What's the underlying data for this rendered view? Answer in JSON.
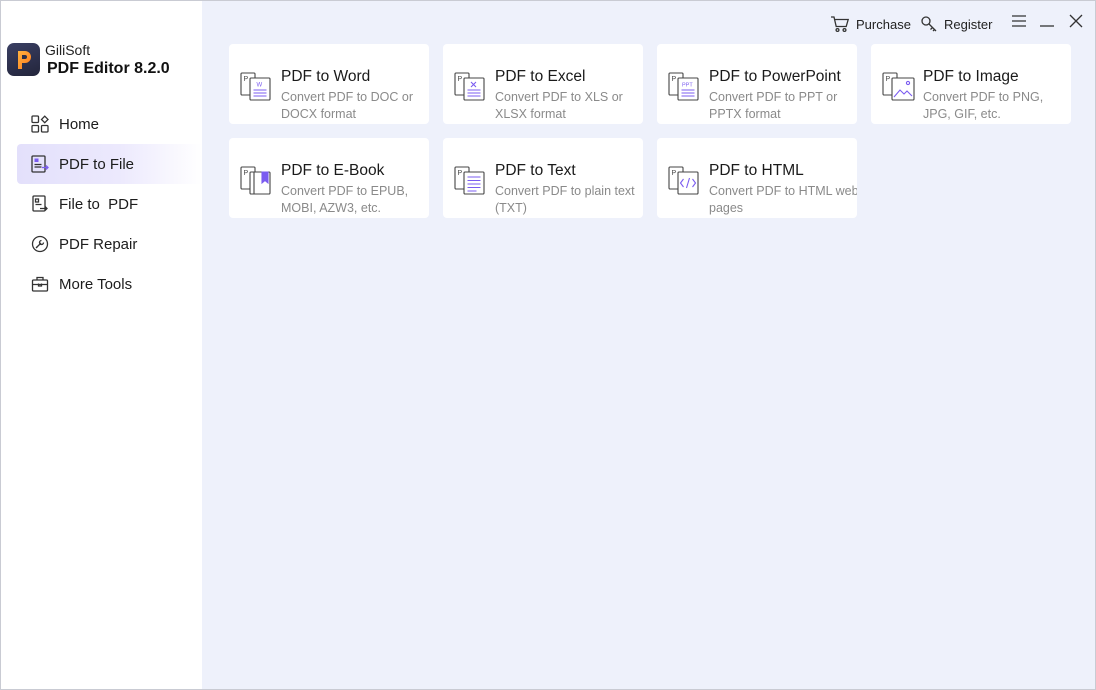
{
  "app": {
    "vendor": "GiliSoft",
    "product": "PDF Editor 8.2.0",
    "accent_color": "#7b5cf0"
  },
  "titlebar": {
    "purchase_label": "Purchase",
    "register_label": "Register"
  },
  "sidebar": {
    "items": [
      {
        "label": "Home",
        "icon": "home-grid-icon",
        "active": false
      },
      {
        "label": "PDF to File",
        "icon": "pdf-to-file-icon",
        "active": true
      },
      {
        "label": "File to  PDF",
        "icon": "file-to-pdf-icon",
        "active": false
      },
      {
        "label": "PDF Repair",
        "icon": "repair-icon",
        "active": false
      },
      {
        "label": "More Tools",
        "icon": "toolbox-icon",
        "active": false
      }
    ]
  },
  "tools": [
    {
      "title": "PDF to Word",
      "description": "Convert PDF to DOC or DOCX format",
      "icon": "pdf-word-icon"
    },
    {
      "title": "PDF to Excel",
      "description": "Convert PDF to XLS or XLSX format",
      "icon": "pdf-excel-icon"
    },
    {
      "title": "PDF to PowerPoint",
      "description": "Convert PDF to PPT or PPTX format",
      "icon": "pdf-powerpoint-icon"
    },
    {
      "title": "PDF to Image",
      "description": "Convert PDF to PNG, JPG, GIF, etc.",
      "icon": "pdf-image-icon"
    },
    {
      "title": "PDF to E-Book",
      "description": "Convert PDF to EPUB, MOBI, AZW3, etc.",
      "icon": "pdf-ebook-icon"
    },
    {
      "title": "PDF to Text",
      "description": "Convert PDF to plain text (TXT)",
      "icon": "pdf-text-icon"
    },
    {
      "title": "PDF to HTML",
      "description": "Convert PDF to HTML web pages",
      "icon": "pdf-html-icon"
    }
  ]
}
